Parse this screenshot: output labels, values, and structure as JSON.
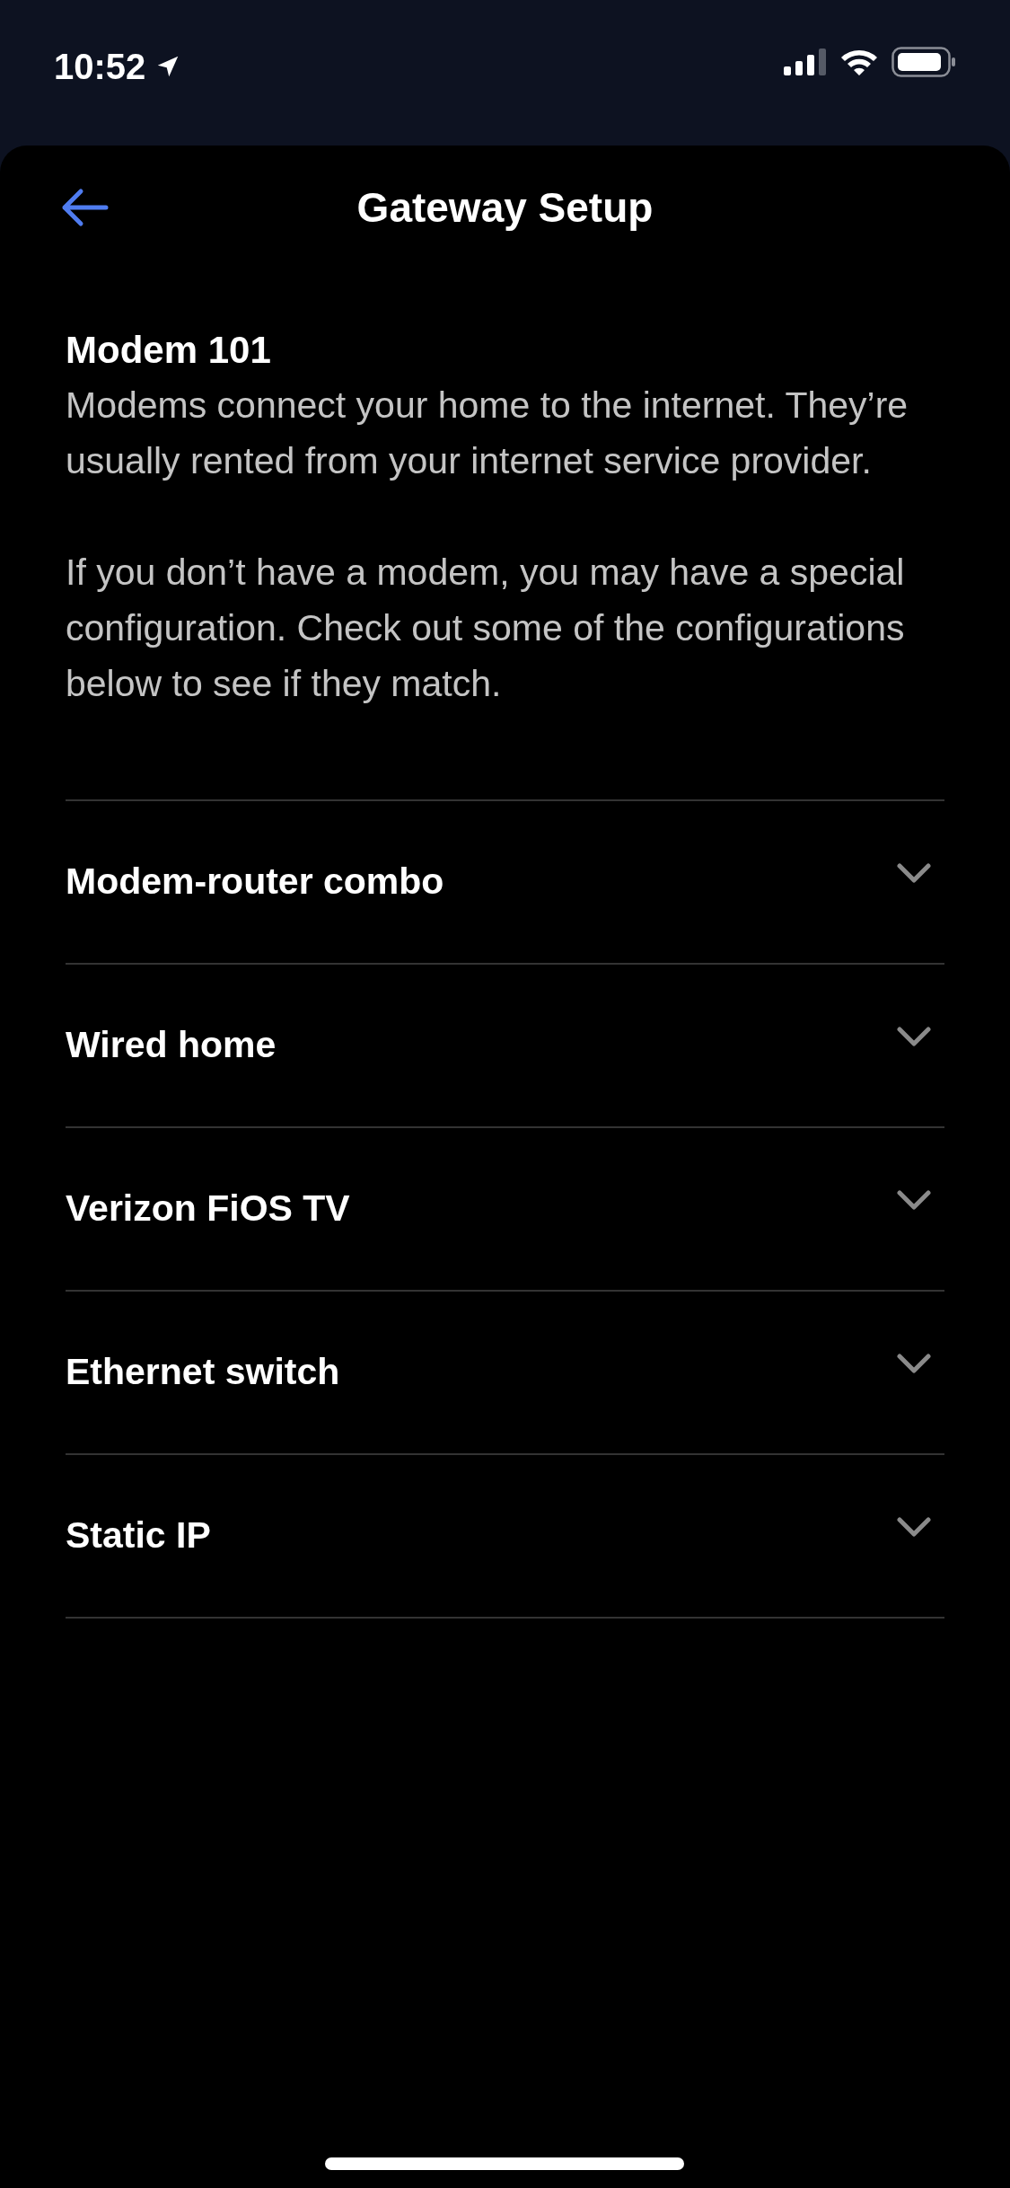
{
  "status_bar": {
    "time": "10:52"
  },
  "header": {
    "title": "Gateway Setup"
  },
  "intro": {
    "heading": "Modem 101",
    "paragraphs": [
      "Modems connect your home to the internet. They’re usually rented from your internet service provider.",
      "If you don’t have a modem, you may have a special configuration. Check out some of the configurations below to see if they match."
    ]
  },
  "configurations": [
    {
      "label": "Modem-router combo",
      "expanded": false
    },
    {
      "label": "Wired home",
      "expanded": false
    },
    {
      "label": "Verizon FiOS TV",
      "expanded": false
    },
    {
      "label": "Ethernet switch",
      "expanded": false
    },
    {
      "label": "Static IP",
      "expanded": false
    }
  ]
}
